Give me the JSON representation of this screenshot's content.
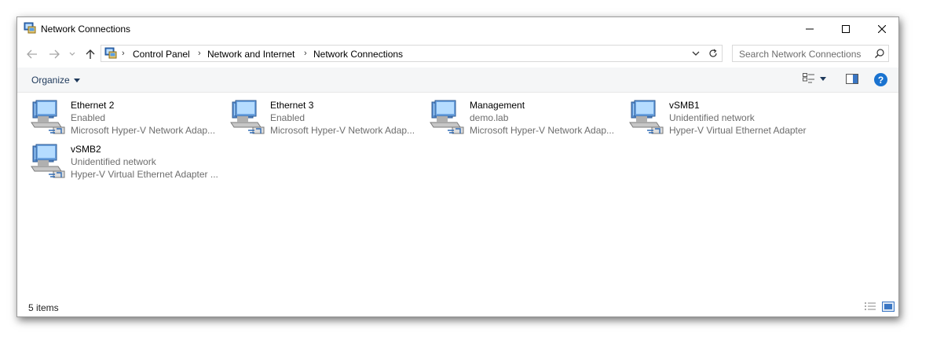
{
  "window": {
    "title": "Network Connections",
    "icon": "network-connections-icon",
    "controls": {
      "minimize": "minimize-icon",
      "maximize": "maximize-icon",
      "close": "close-icon"
    }
  },
  "navigation": {
    "breadcrumbs": [
      "Control Panel",
      "Network and Internet",
      "Network Connections"
    ]
  },
  "search": {
    "placeholder": "Search Network Connections"
  },
  "toolbar": {
    "organize_label": "Organize"
  },
  "connections": [
    {
      "name": "Ethernet 2",
      "status": "Enabled",
      "device": "Microsoft Hyper-V Network Adap..."
    },
    {
      "name": "Ethernet 3",
      "status": "Enabled",
      "device": "Microsoft Hyper-V Network Adap..."
    },
    {
      "name": "Management",
      "status": "demo.lab",
      "device": "Microsoft Hyper-V Network Adap..."
    },
    {
      "name": "vSMB1",
      "status": "Unidentified network",
      "device": "Hyper-V Virtual Ethernet Adapter"
    },
    {
      "name": "vSMB2",
      "status": "Unidentified network",
      "device": "Hyper-V Virtual Ethernet Adapter ..."
    }
  ],
  "status": {
    "item_count": "5 items"
  },
  "colors": {
    "accent": "#1a73d0",
    "link": "#1e395b",
    "secondary_text": "#6d6d6d"
  }
}
